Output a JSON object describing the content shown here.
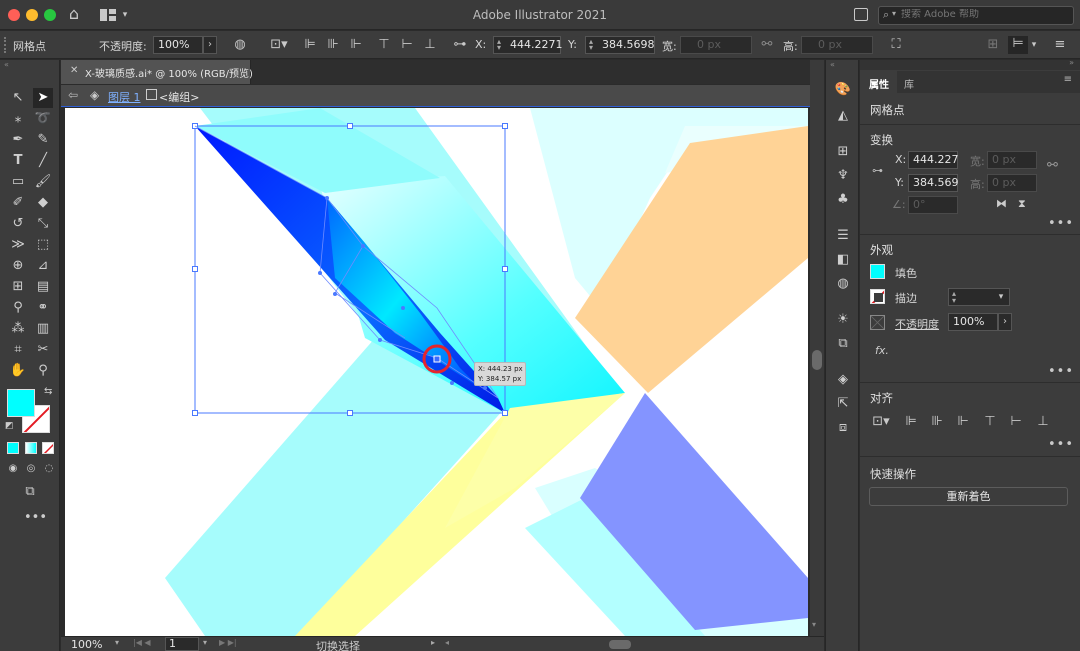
{
  "window": {
    "title": "Adobe Illustrator 2021",
    "search_placeholder": "搜索 Adobe 帮助"
  },
  "control_bar": {
    "selection_label": "网格点",
    "opacity_label": "不透明度:",
    "opacity_value": "100%",
    "x_label": "X:",
    "x_value": "444.2271",
    "y_label": "Y:",
    "y_value": "384.5698",
    "width_label": "宽:",
    "width_value": "0 px",
    "height_label": "高:",
    "height_value": "0 px"
  },
  "document": {
    "tab_title": "X-玻璃质感.ai* @ 100% (RGB/预览)",
    "layer_label": "图层 1",
    "group_label": "<编组>",
    "tooltip_x": "X: 444.23 px",
    "tooltip_y": "Y: 384.57 px"
  },
  "status_bar": {
    "zoom": "100%",
    "artboard": "1",
    "status_text": "切换选择"
  },
  "panel": {
    "tabs": [
      "属性",
      "库"
    ],
    "selection_type": "网格点",
    "transform": {
      "title": "变换",
      "x_label": "X:",
      "x_value": "444.227",
      "y_label": "Y:",
      "y_value": "384.569",
      "w_label": "宽:",
      "w_value": "0 px",
      "h_label": "高:",
      "h_value": "0 px",
      "angle_value": "0°"
    },
    "appearance": {
      "title": "外观",
      "fill_label": "填色",
      "stroke_label": "描边",
      "opacity_label": "不透明度",
      "opacity_value": "100%",
      "fx_label": "fx."
    },
    "align": {
      "title": "对齐"
    },
    "quick_actions": {
      "title": "快速操作",
      "recolor_button": "重新着色"
    }
  },
  "colors": {
    "fill_swatch": "#00ffff",
    "accent_blue": "#2f5fd5"
  },
  "icons": {
    "home": "home-icon",
    "workspace": "workspace-icon",
    "search": "search-icon",
    "selection": "selection-tool-icon",
    "direct_selection": "direct-selection-tool-icon"
  }
}
